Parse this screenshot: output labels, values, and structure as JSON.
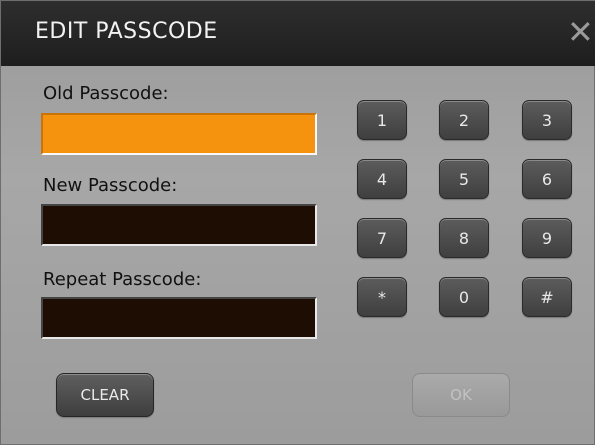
{
  "dialog": {
    "title": "EDIT PASSCODE",
    "close_glyph": "✕",
    "close_icon": "close-icon"
  },
  "fields": {
    "old_label": "Old Passcode:",
    "new_label": "New Passcode:",
    "repeat_label": "Repeat Passcode:",
    "old_value": "",
    "new_value": "",
    "repeat_value": ""
  },
  "keypad": {
    "keys": [
      "1",
      "2",
      "3",
      "4",
      "5",
      "6",
      "7",
      "8",
      "9",
      "*",
      "0",
      "#"
    ]
  },
  "buttons": {
    "clear_label": "CLEAR",
    "ok_label": "OK"
  },
  "colors": {
    "active_field": "#f5920e",
    "inactive_field": "#1d0d03",
    "title_bar": "#262626"
  }
}
